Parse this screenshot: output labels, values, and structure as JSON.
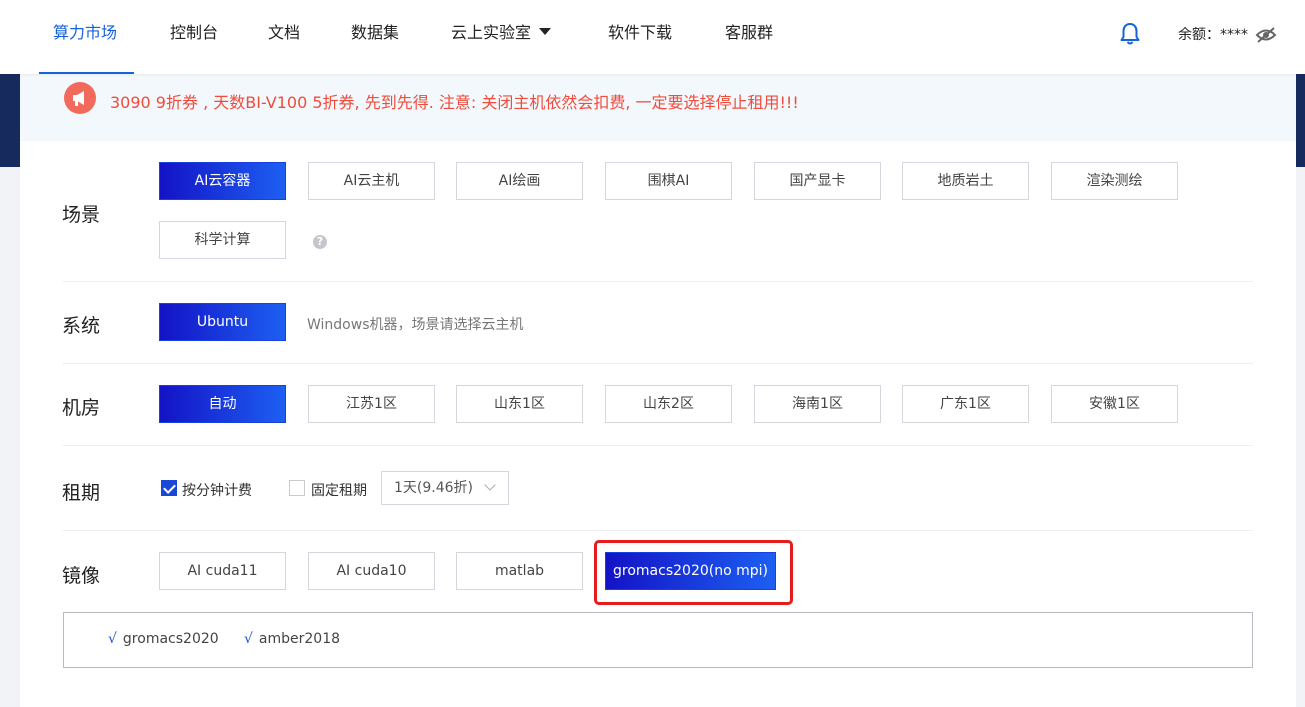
{
  "nav": {
    "items": [
      {
        "label": "算力市场",
        "active": true
      },
      {
        "label": "控制台"
      },
      {
        "label": "文档"
      },
      {
        "label": "数据集"
      },
      {
        "label": "云上实验室"
      },
      {
        "label": "软件下载"
      },
      {
        "label": "客服群"
      }
    ],
    "balance_label": "余额：****",
    "icons": [
      "bell-icon",
      "eye-off-icon",
      "chevron-down-icon"
    ]
  },
  "notice": {
    "text": "3090 9折券 , 天数BI-V100 5折券, 先到先得. 注意: 关闭主机依然会扣费, 一定要选择停止租用!!!"
  },
  "scene": {
    "label": "场景",
    "options": [
      "AI云容器",
      "AI云主机",
      "AI绘画",
      "围棋AI",
      "国产显卡",
      "地质岩土",
      "渲染测绘",
      "科学计算"
    ],
    "selected": "AI云容器",
    "help": "?"
  },
  "system": {
    "label": "系统",
    "options": [
      "Ubuntu"
    ],
    "selected": "Ubuntu",
    "hint": "Windows机器，场景请选择云主机"
  },
  "room": {
    "label": "机房",
    "options": [
      "自动",
      "江苏1区",
      "山东1区",
      "山东2区",
      "海南1区",
      "广东1区",
      "安徽1区"
    ],
    "selected": "自动"
  },
  "term": {
    "label": "租期",
    "per_minute": {
      "label": "按分钟计费",
      "checked": true
    },
    "fixed": {
      "label": "固定租期",
      "checked": false
    },
    "select_value": "1天(9.46折)"
  },
  "image": {
    "label": "镜像",
    "options": [
      "AI cuda11",
      "AI cuda10",
      "matlab",
      "gromacs2020(no mpi)"
    ],
    "selected": "gromacs2020(no mpi)",
    "packages": [
      "gromacs2020",
      "amber2018"
    ],
    "tick": "√"
  },
  "colors": {
    "accent": "#1663d8",
    "selected_gradient_start": "#1313c6",
    "selected_gradient_end": "#1d5ff2",
    "notice_text": "#ef4c3c",
    "highlight": "#e61c1c"
  }
}
